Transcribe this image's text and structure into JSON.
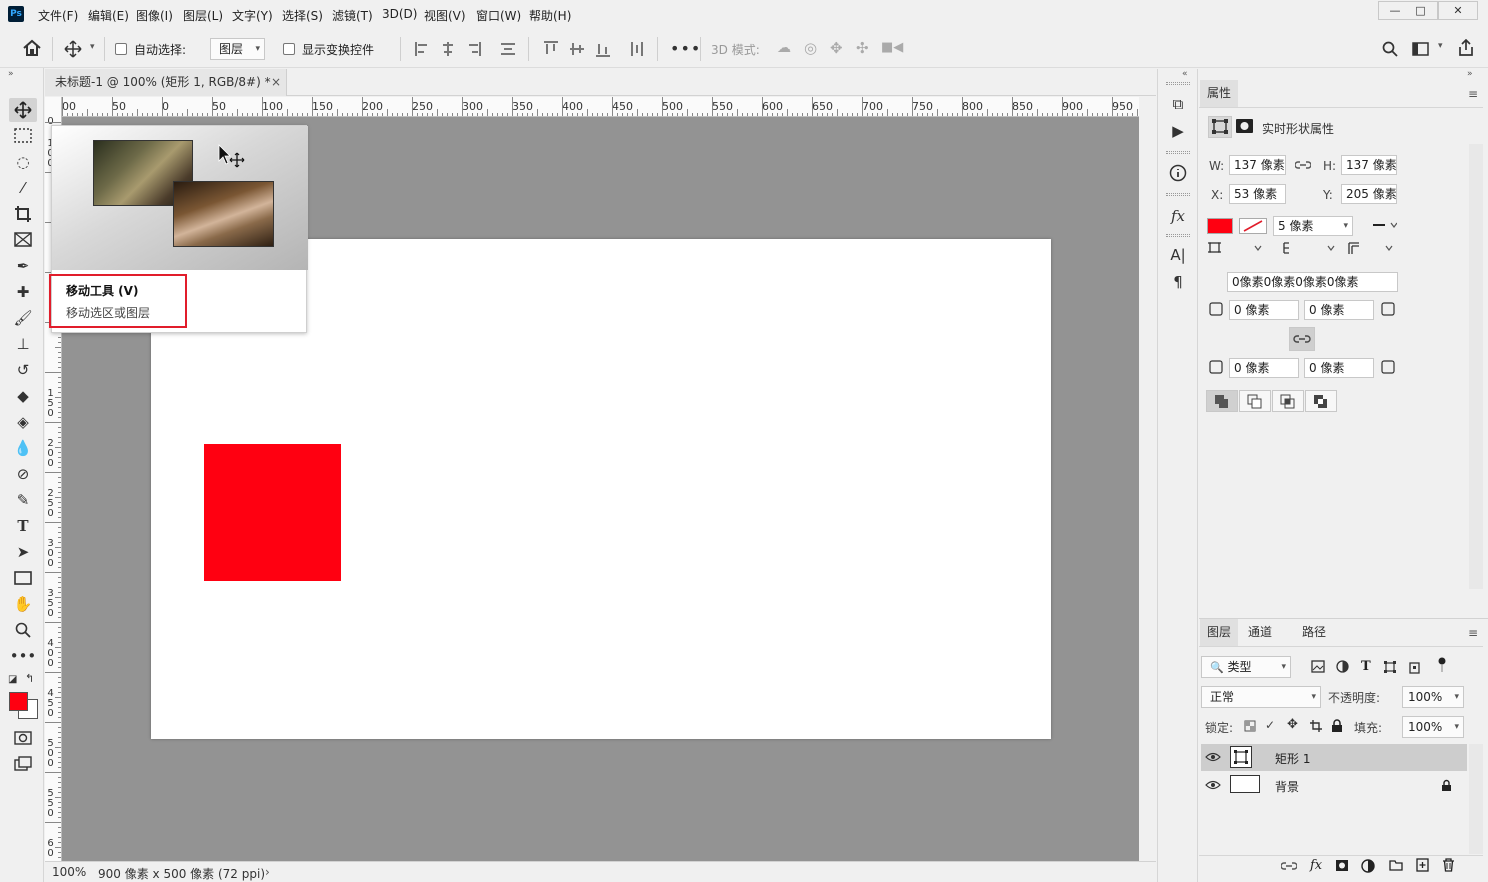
{
  "menubar": {
    "logo": "Ps",
    "items": [
      "文件(F)",
      "编辑(E)",
      "图像(I)",
      "图层(L)",
      "文字(Y)",
      "选择(S)",
      "滤镜(T)",
      "3D(D)",
      "视图(V)",
      "窗口(W)",
      "帮助(H)"
    ],
    "window_buttons": [
      "—",
      "□",
      "✕"
    ]
  },
  "options": {
    "auto_select_label": "自动选择:",
    "auto_select_target": "图层",
    "show_transform_label": "显示变换控件",
    "mode_3d_label": "3D 模式:"
  },
  "document": {
    "tab_title": "未标题-1 @ 100% (矩形 1, RGB/8#) *",
    "tab_close": "×",
    "ruler_top_labels": [
      "00",
      "50",
      "0",
      "50",
      "100",
      "150",
      "200",
      "250",
      "300",
      "350",
      "400",
      "450",
      "500",
      "550",
      "600",
      "650",
      "700",
      "750",
      "800",
      "850",
      "900",
      "950"
    ],
    "ruler_left_labels": [
      "0",
      "1\n0\n0",
      "1\n5\n0",
      "2\n0\n0",
      "2\n5\n0",
      "3\n0\n0",
      "3\n5\n0",
      "4\n0\n0",
      "4\n5\n0",
      "5\n0\n0",
      "5\n5\n0",
      "6\n0"
    ],
    "canvas_size": "900 像素 x 500 像素 (72 ppi)",
    "zoom": "100%",
    "shape_color": "#ff0011"
  },
  "tooltip": {
    "title": "移动工具 (V)",
    "description": "移动选区或图层"
  },
  "toolbar": {
    "foreground_color": "#ff0011",
    "background_color": "#ffffff"
  },
  "properties": {
    "tab_label": "属性",
    "section_title": "实时形状属性",
    "w_label": "W:",
    "w_value": "137 像素",
    "h_label": "H:",
    "h_value": "137 像素",
    "x_label": "X:",
    "x_value": "53 像素",
    "y_label": "Y:",
    "y_value": "205 像素",
    "fill_color": "#ff0011",
    "stroke_width": "5 像素",
    "corner_radii_summary": "0像素0像素0像素0像素",
    "corner_tl": "0 像素",
    "corner_tr": "0 像素",
    "corner_bl": "0 像素",
    "corner_br": "0 像素"
  },
  "layers": {
    "tabs": [
      "图层",
      "通道",
      "路径"
    ],
    "filter_label": "类型",
    "blend_mode": "正常",
    "opacity_label": "不透明度:",
    "opacity_value": "100%",
    "lock_label": "锁定:",
    "fill_label": "填充:",
    "fill_value": "100%",
    "rows": [
      {
        "name": "矩形 1"
      },
      {
        "name": "背景"
      }
    ]
  }
}
